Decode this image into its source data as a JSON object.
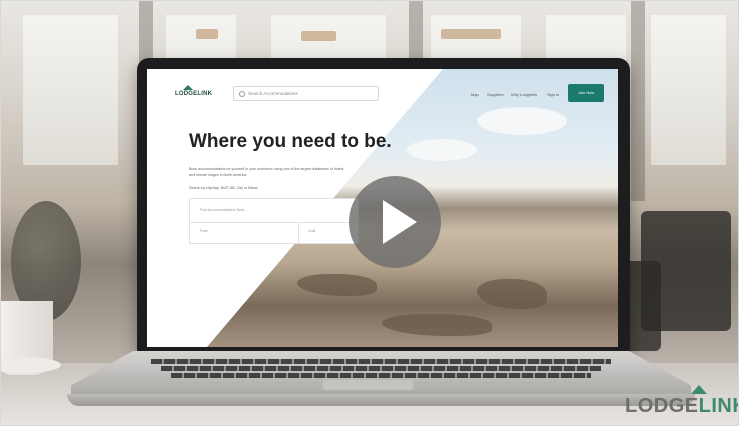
{
  "video": {
    "play_label": "Play video"
  },
  "watermark": {
    "part1": "LODGE",
    "part2": "LINK"
  },
  "site": {
    "logo": "LODGELINK",
    "search_placeholder": "Search Accommodations",
    "nav": [
      "Map",
      "Suppliers",
      "Why Lodgelink",
      "Sign in"
    ],
    "cta": "Join Now",
    "hero_title": "Where you need to be.",
    "hero_sub": "Book accommodations for yourself or your workforce using one of the largest databases of hotels and remote lodges in North America",
    "hero_note": "Search by city/hwy. NWT-AB, City or Name",
    "form_search": "Find Accommodations Near...",
    "form_from": "From",
    "form_to": "Until"
  },
  "colors": {
    "accent": "#1a7a6d",
    "logo_green": "#3d8a6d"
  }
}
